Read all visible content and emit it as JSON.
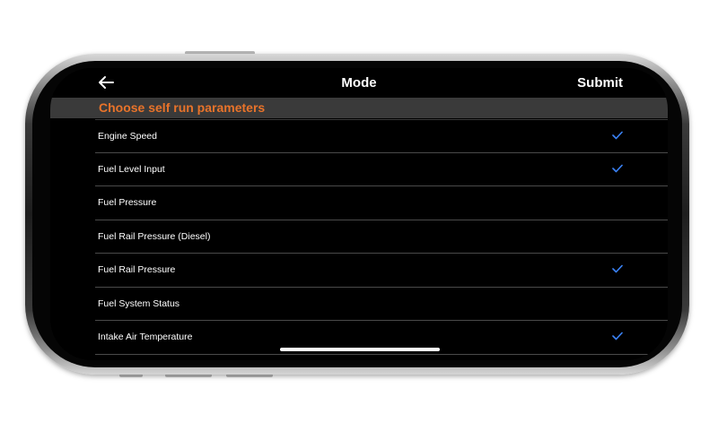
{
  "nav": {
    "back_icon": "arrow-left-icon",
    "title": "Mode",
    "submit_label": "Submit"
  },
  "section": {
    "title": "Choose self run parameters"
  },
  "parameters": [
    {
      "label": "Engine Speed",
      "checked": true
    },
    {
      "label": "Fuel Level Input",
      "checked": true
    },
    {
      "label": "Fuel Pressure",
      "checked": false
    },
    {
      "label": "Fuel Rail Pressure (Diesel)",
      "checked": false
    },
    {
      "label": "Fuel Rail Pressure",
      "checked": true
    },
    {
      "label": "Fuel System Status",
      "checked": false
    },
    {
      "label": "Intake Air Temperature",
      "checked": true
    }
  ],
  "colors": {
    "accent_orange": "#e8732a",
    "check_blue": "#3a82f7",
    "section_bg": "#3a3a3a",
    "screen_bg": "#000000"
  }
}
